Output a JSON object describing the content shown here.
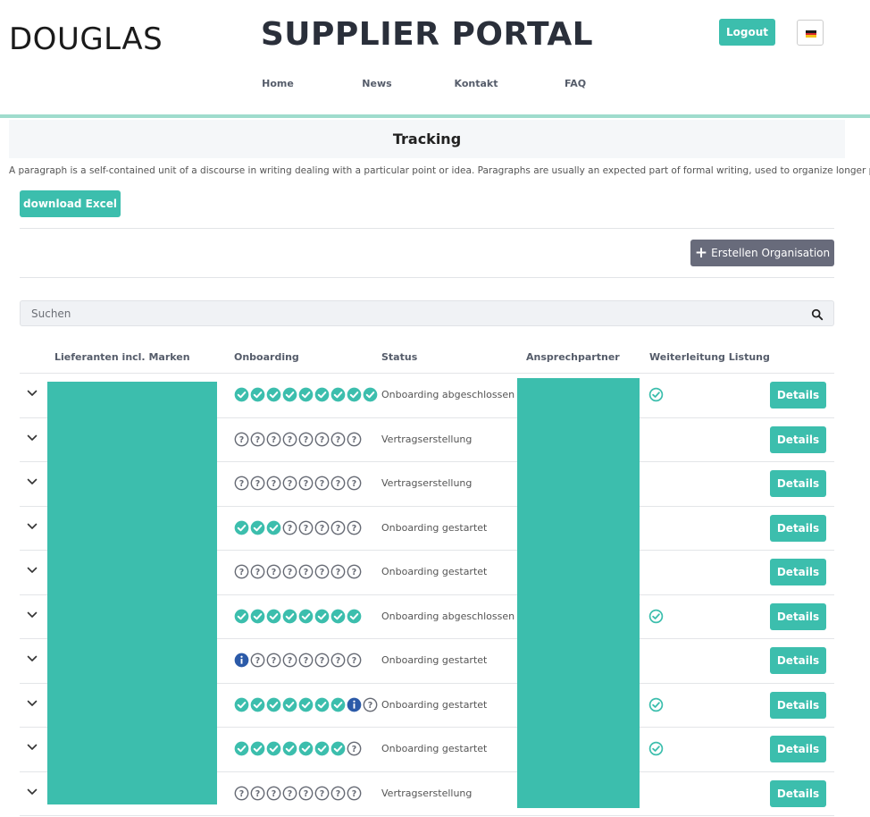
{
  "header": {
    "logo_text": "DOUGLAS",
    "portal_title": "SUPPLIER PORTAL",
    "logout_label": "Logout",
    "language": "DE",
    "nav": [
      {
        "label": "Home"
      },
      {
        "label": "News"
      },
      {
        "label": "Kontakt"
      },
      {
        "label": "FAQ"
      }
    ]
  },
  "page": {
    "title": "Tracking",
    "intro": "A paragraph is a self-contained unit of a discourse in writing dealing with a particular point or idea. Paragraphs are usually an expected part of formal writing, used to organize longer prose.",
    "download_label": "download Excel",
    "create_label": "Erstellen Organisation",
    "search_placeholder": "Suchen"
  },
  "table": {
    "columns": [
      "Lieferanten incl. Marken",
      "Onboarding",
      "Status",
      "Ansprechpartner",
      "Weiterleitung Listung"
    ],
    "details_label": "Details",
    "rows": [
      {
        "steps": "ccccccccc",
        "status": "Onboarding abgeschlossen",
        "forwarded": true
      },
      {
        "steps": "qqqqqqqq",
        "status": "Vertragserstellung",
        "forwarded": false
      },
      {
        "steps": "qqqqqqqq",
        "status": "Vertragserstellung",
        "forwarded": false
      },
      {
        "steps": "cccqqqqq",
        "status": "Onboarding gestartet",
        "forwarded": false
      },
      {
        "steps": "qqqqqqqq",
        "status": "Onboarding gestartet",
        "forwarded": false
      },
      {
        "steps": "cccccccc",
        "status": "Onboarding abgeschlossen",
        "forwarded": true
      },
      {
        "steps": "iqqqqqqq",
        "status": "Onboarding gestartet",
        "forwarded": false
      },
      {
        "steps": "ccccccciq",
        "status": "Onboarding gestartet",
        "forwarded": true
      },
      {
        "steps": "cccccccq",
        "status": "Onboarding gestartet",
        "forwarded": true
      },
      {
        "steps": "qqqqqqqq",
        "status": "Vertragserstellung",
        "forwarded": false
      }
    ]
  },
  "colors": {
    "accent": "#3cbead",
    "secondary_button": "#686b7b",
    "info": "#2b5aa8",
    "pending": "#666a74"
  },
  "icons": {
    "done": "check-circle-icon",
    "pending": "question-circle-icon",
    "info": "info-circle-icon",
    "forwarded": "check-outline-circle-icon",
    "expand": "chevron-down-icon",
    "search": "search-icon",
    "create": "plus-icon"
  }
}
